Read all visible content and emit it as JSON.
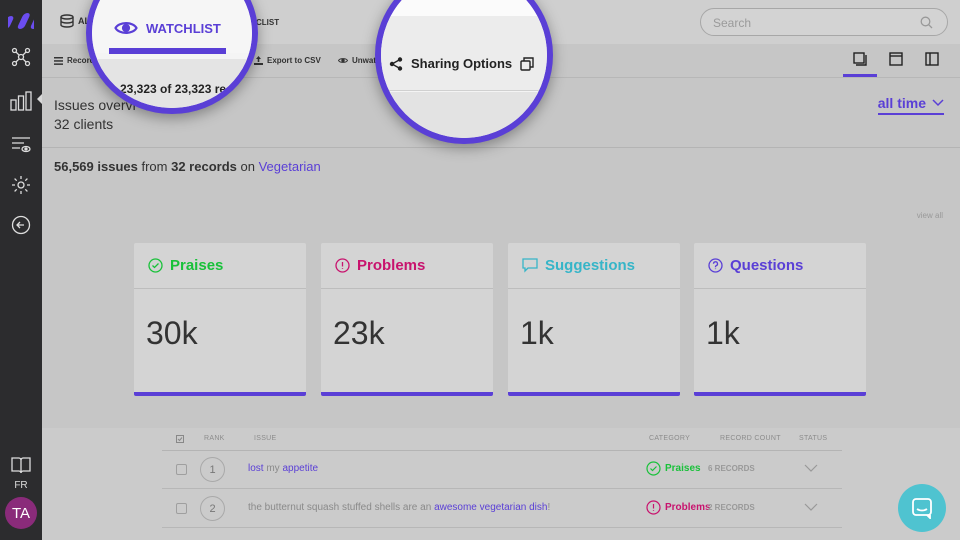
{
  "topbar": {
    "all_label": "AL",
    "watchlist_partial": "CLIST",
    "search_placeholder": "Search"
  },
  "toolbar": {
    "records_label": "Record",
    "export_label": "Export to CSV",
    "unwatch_label": "Unwat",
    "views": [
      "card-view-icon",
      "single-view-icon",
      "split-view-icon"
    ]
  },
  "magnifier_watchlist": {
    "title": "WATCHLIST",
    "count": "23,323 of 23,323 re"
  },
  "magnifier_sharing": {
    "label": "Sharing Options"
  },
  "overview": {
    "title": "Issues overvi",
    "subtitle": "32 clients",
    "period": "all time",
    "summary_issues": "56,569 issues",
    "summary_from": "from",
    "summary_records": "32 records",
    "summary_on": "on",
    "summary_topic": "Vegetarian",
    "view_all": "view all"
  },
  "cards": [
    {
      "label": "Praises",
      "value": "30k",
      "color": "#19c13a",
      "icon": "check-circle-icon"
    },
    {
      "label": "Problems",
      "value": "23k",
      "color": "#c8136e",
      "icon": "exclamation-circle-icon"
    },
    {
      "label": "Suggestions",
      "value": "1k",
      "color": "#36b5c8",
      "icon": "speech-bubble-icon"
    },
    {
      "label": "Questions",
      "value": "1k",
      "color": "#5a3fd6",
      "icon": "question-circle-icon"
    }
  ],
  "table": {
    "headers": {
      "rank": "RANK",
      "issue": "ISSUE",
      "category": "CATEGORY",
      "record_count": "RECORD COUNT",
      "status": "STATUS"
    },
    "rows": [
      {
        "rank": "1",
        "issue_parts": [
          {
            "t": "lost",
            "hl": true
          },
          {
            "t": " my ",
            "hl": false
          },
          {
            "t": "appetite",
            "hl": true
          }
        ],
        "category": "Praises",
        "records": "6 RECORDS"
      },
      {
        "rank": "2",
        "issue_parts": [
          {
            "t": "the butternut squash stuffed shells are an ",
            "hl": false
          },
          {
            "t": "awesome vegetarian dish",
            "hl": true
          },
          {
            "t": "!",
            "hl": false
          }
        ],
        "category": "Problems",
        "records": "2 RECORDS"
      }
    ]
  },
  "sidebar": {
    "language": "FR",
    "avatar_initials": "TA"
  }
}
